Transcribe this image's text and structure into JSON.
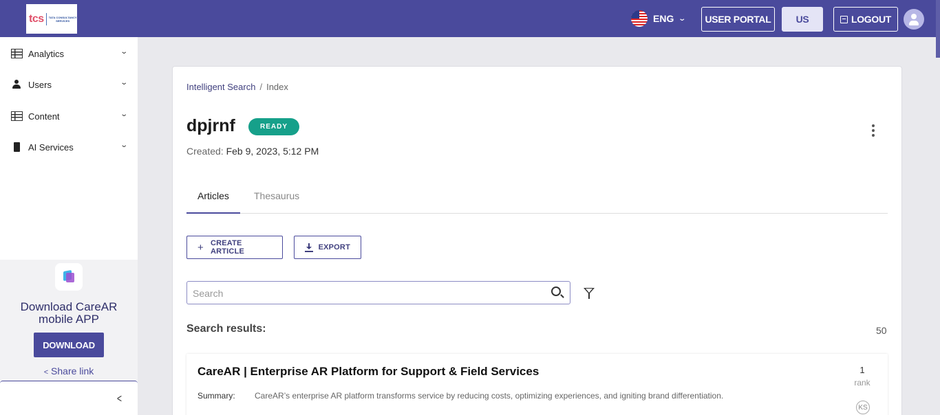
{
  "header": {
    "logo_brand": "tcs",
    "logo_company": "TATA CONSULTANCY SERVICES",
    "language": "ENG",
    "user_portal_label": "USER PORTAL",
    "region_label": "US",
    "logout_label": "LOGOUT",
    "bar_color": "#4a4a9c"
  },
  "sidebar": {
    "items": [
      {
        "label": "Analytics",
        "icon": "table-icon"
      },
      {
        "label": "Users",
        "icon": "users-icon"
      },
      {
        "label": "Content",
        "icon": "table-icon"
      },
      {
        "label": "AI Services",
        "icon": "chip-icon"
      }
    ],
    "promo": {
      "title_line1": "Download CareAR",
      "title_line2": "mobile APP",
      "download_label": "DOWNLOAD",
      "share_label": "Share link"
    }
  },
  "main": {
    "breadcrumb": {
      "root": "Intelligent Search",
      "separator": "/",
      "current": "Index"
    },
    "title": "dpjrnf",
    "status": "READY",
    "status_color": "#16a08a",
    "created_label": "Created:",
    "created_value": "Feb 9, 2023, 5:12 PM",
    "tabs": [
      {
        "label": "Articles",
        "active": true
      },
      {
        "label": "Thesaurus",
        "active": false
      }
    ],
    "create_label": "CREATE ARTICLE",
    "export_label": "EXPORT",
    "search": {
      "placeholder": "Search",
      "value": ""
    },
    "results_label": "Search results:",
    "results_count": "50",
    "results": [
      {
        "title": "CareAR | Enterprise AR Platform for Support & Field Services",
        "rank": "1",
        "rank_label": "rank",
        "badge": "KS",
        "summary_label": "Summary:",
        "summary": "CareAR’s enterprise AR platform transforms service by reducing costs, optimizing experiences, and igniting brand differentiation."
      }
    ]
  }
}
